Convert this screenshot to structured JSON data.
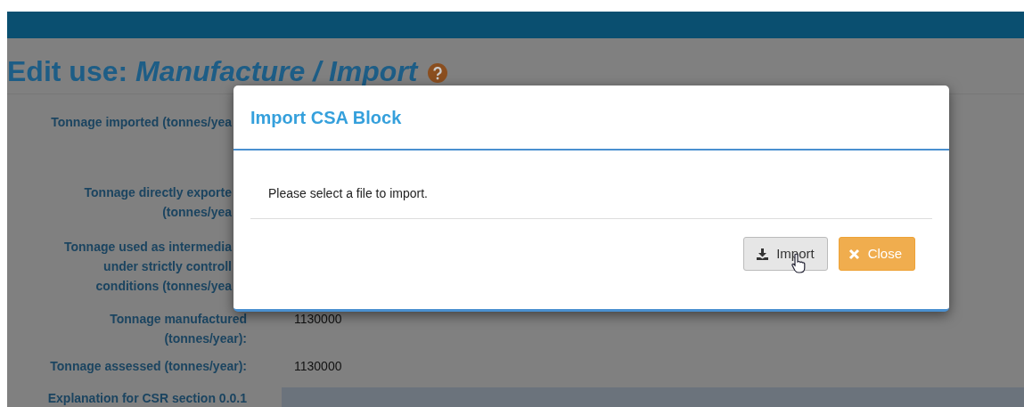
{
  "page_title": "Edit use: *Manufacture / Import*",
  "fields": [
    {
      "label": [
        "Tonnage imported (tonnes/yea"
      ]
    },
    {
      "label": [
        "Tonnage directly exporte",
        "(tonnes/yea"
      ]
    },
    {
      "label": [
        "Tonnage used as intermedia",
        "under strictly controll",
        "conditions (tonnes/yea"
      ]
    },
    {
      "label": [
        "Tonnage manufactured",
        "(tonnes/year):"
      ],
      "value": "1130000"
    },
    {
      "label": [
        "Tonnage assessed (tonnes/year):"
      ],
      "value": "1130000"
    },
    {
      "label": [
        "Explanation for CSR section 0.0.1"
      ],
      "kind": "textarea"
    }
  ],
  "modal": {
    "title": "Import CSA Block",
    "message": "Please select a file to import.",
    "buttons": [
      {
        "label": "Import",
        "kind": "default",
        "hovered": true
      },
      {
        "label": "Close",
        "kind": "warning",
        "hovered": false
      }
    ]
  }
}
